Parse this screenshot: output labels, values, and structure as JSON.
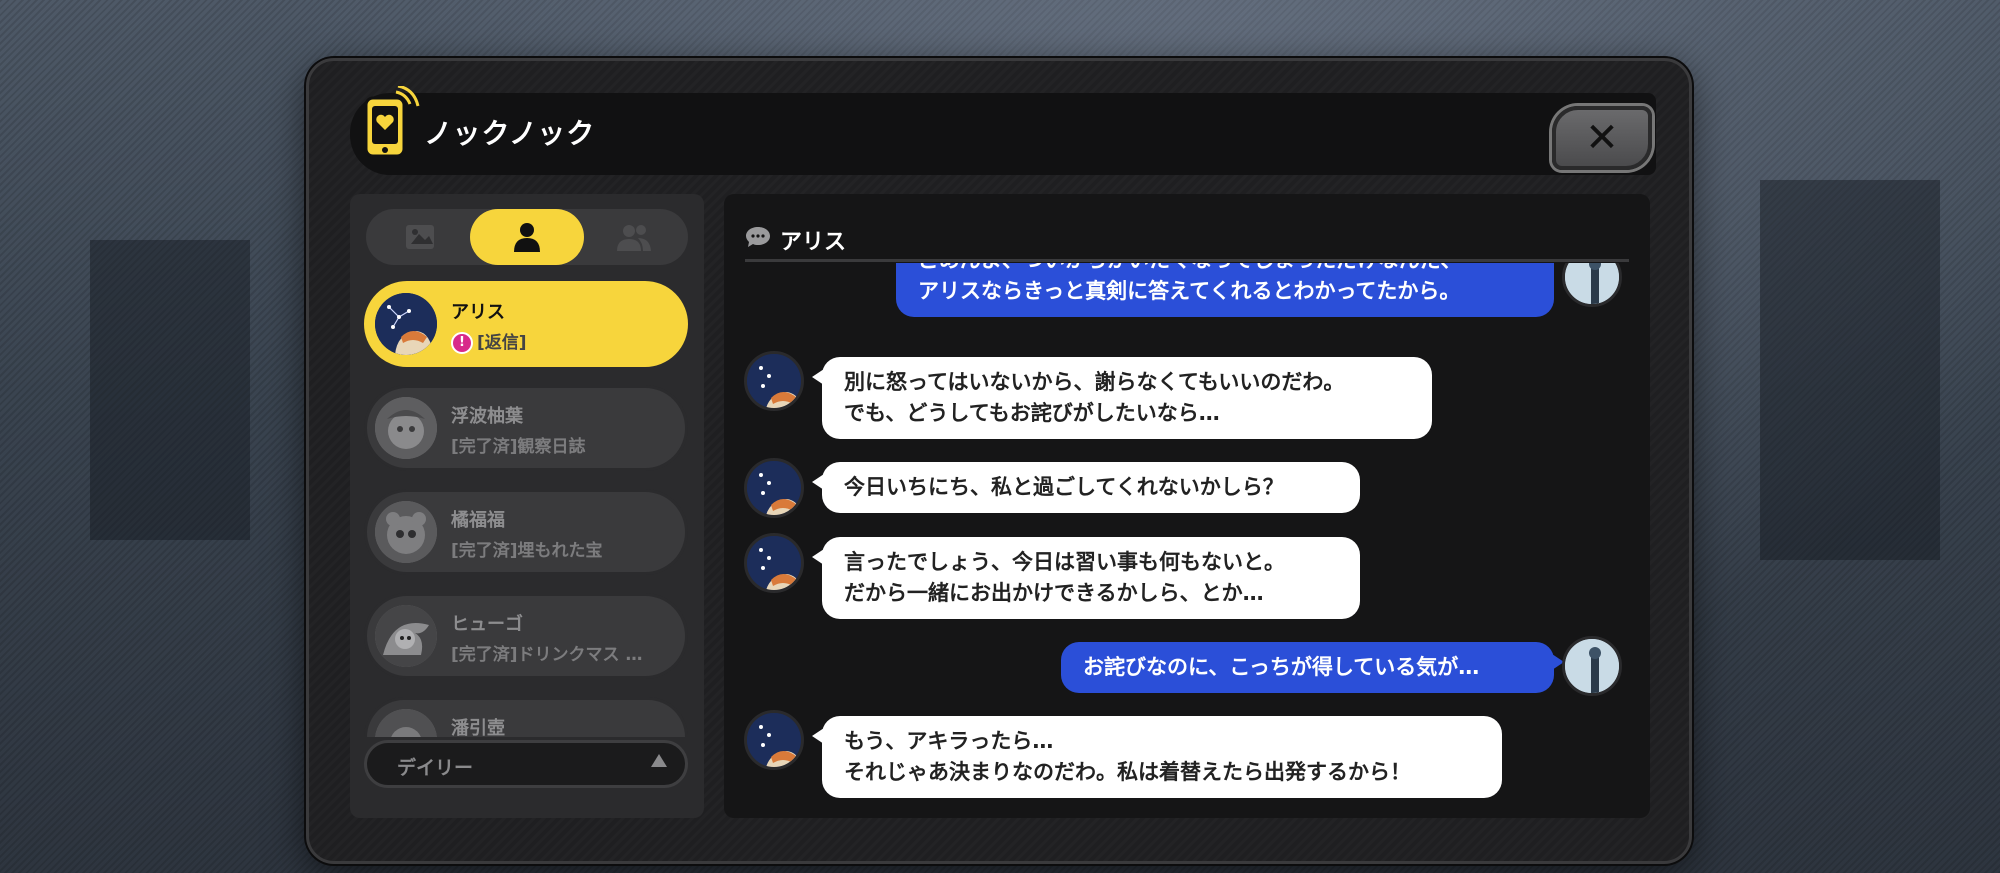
{
  "window": {
    "title": "ノックノック",
    "close_label": "✕"
  },
  "tabs": [
    {
      "icon": "card-icon",
      "active": false
    },
    {
      "icon": "person-icon",
      "active": true
    },
    {
      "icon": "group-icon",
      "active": false
    }
  ],
  "contacts": [
    {
      "name": "アリス",
      "status": "[返信]",
      "badge": "!",
      "active": true
    },
    {
      "name": "浮波柚葉",
      "status": "[完了済]観察日誌",
      "active": false
    },
    {
      "name": "橘福福",
      "status": "[完了済]埋もれた宝",
      "active": false
    },
    {
      "name": "ヒューゴ",
      "status": "[完了済]ドリンクマス …",
      "active": false
    },
    {
      "name": "潘引壺",
      "status": "",
      "active": false
    }
  ],
  "filter": {
    "label": "デイリー"
  },
  "chat": {
    "contact_name": "アリス",
    "messages": [
      {
        "from": "me",
        "text": "ごめんよ、ついからかいたくなってしまっただけなんだ、\nアリスならきっと真剣に答えてくれるとわかってたから。"
      },
      {
        "from": "alice",
        "text": "別に怒ってはいないから、謝らなくてもいいのだわ。\nでも、どうしてもお詫びがしたいなら…"
      },
      {
        "from": "alice",
        "text": "今日いちにち、私と過ごしてくれないかしら？"
      },
      {
        "from": "alice",
        "text": "言ったでしょう、今日は習い事も何もないと。\nだから一緒にお出かけできるかしら、とか…"
      },
      {
        "from": "me",
        "text": "お詫びなのに、こっちが得している気が…"
      },
      {
        "from": "alice",
        "text": "もう、アキラったら…\nそれじゃあ決まりなのだわ。私は着替えたら出発するから！"
      }
    ]
  },
  "colors": {
    "accent": "#f7d53c",
    "outgoing_bubble": "#2b4fd8",
    "incoming_bubble": "#ffffff",
    "notify_badge": "#d82a8a"
  }
}
